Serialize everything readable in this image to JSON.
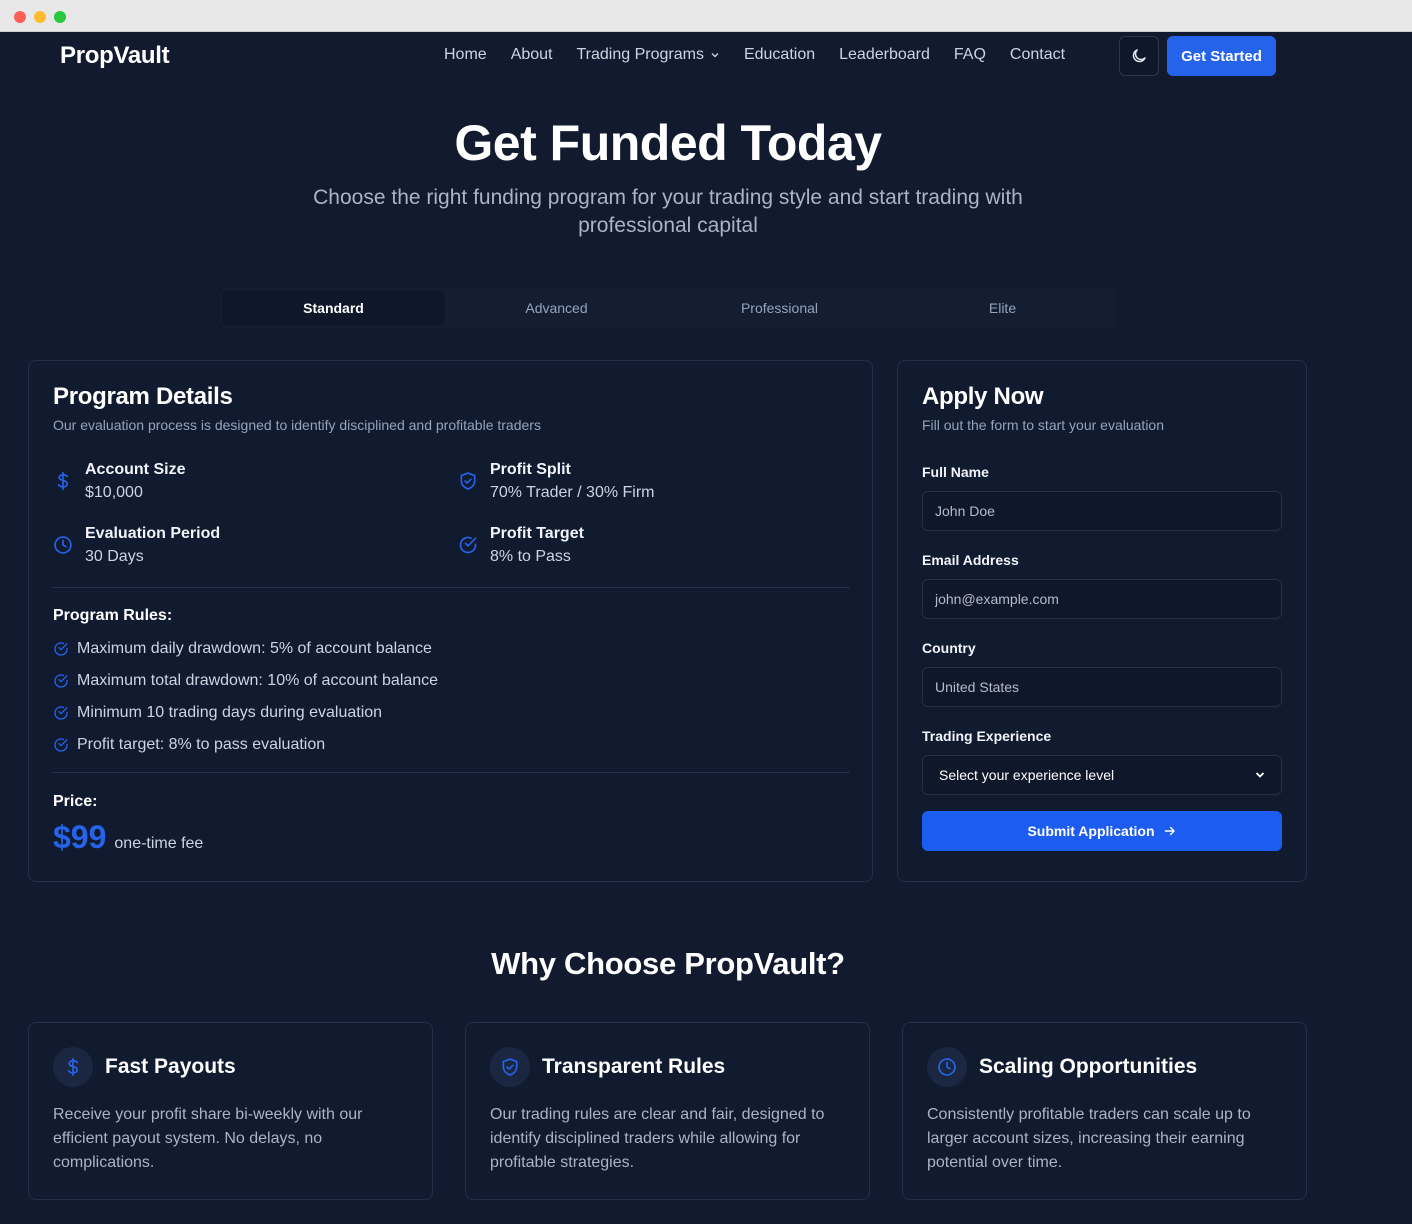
{
  "app": {
    "logo": "PropVault"
  },
  "nav": {
    "items": [
      "Home",
      "About",
      "Trading Programs",
      "Education",
      "Leaderboard",
      "FAQ",
      "Contact"
    ],
    "get_started": "Get Started"
  },
  "hero": {
    "title": "Get Funded Today",
    "subtitle": "Choose the right funding program for your trading style and start trading with professional capital"
  },
  "tabs": [
    "Standard",
    "Advanced",
    "Professional",
    "Elite"
  ],
  "details": {
    "title": "Program Details",
    "description": "Our evaluation process is designed to identify disciplined and profitable traders",
    "stats": [
      {
        "label": "Account Size",
        "value": "$10,000",
        "icon": "dollar-icon"
      },
      {
        "label": "Profit Split",
        "value": "70% Trader / 30% Firm",
        "icon": "shield-icon"
      },
      {
        "label": "Evaluation Period",
        "value": "30 Days",
        "icon": "clock-icon"
      },
      {
        "label": "Profit Target",
        "value": "8% to Pass",
        "icon": "check-circle-icon"
      }
    ],
    "rules_title": "Program Rules:",
    "rules": [
      "Maximum daily drawdown: 5% of account balance",
      "Maximum total drawdown: 10% of account balance",
      "Minimum 10 trading days during evaluation",
      "Profit target: 8% to pass evaluation"
    ],
    "price_label": "Price:",
    "price": "$99",
    "price_note": "one-time fee"
  },
  "apply": {
    "title": "Apply Now",
    "description": "Fill out the form to start your evaluation",
    "full_name_label": "Full Name",
    "full_name_placeholder": "John Doe",
    "email_label": "Email Address",
    "email_placeholder": "john@example.com",
    "country_label": "Country",
    "country_placeholder": "United States",
    "experience_label": "Trading Experience",
    "experience_value": "Select your experience level",
    "submit": "Submit Application"
  },
  "why": {
    "title": "Why Choose PropVault?",
    "features": [
      {
        "title": "Fast Payouts",
        "text": "Receive your profit share bi-weekly with our efficient payout system. No delays, no complications.",
        "icon": "dollar-icon"
      },
      {
        "title": "Transparent Rules",
        "text": "Our trading rules are clear and fair, designed to identify disciplined traders while allowing for profitable strategies.",
        "icon": "shield-icon"
      },
      {
        "title": "Scaling Opportunities",
        "text": "Consistently profitable traders can scale up to larger account sizes, increasing their earning potential over time.",
        "icon": "clock-icon"
      }
    ]
  },
  "colors": {
    "accent": "#2563eb",
    "background": "#111a2e",
    "card": "#111b30"
  }
}
